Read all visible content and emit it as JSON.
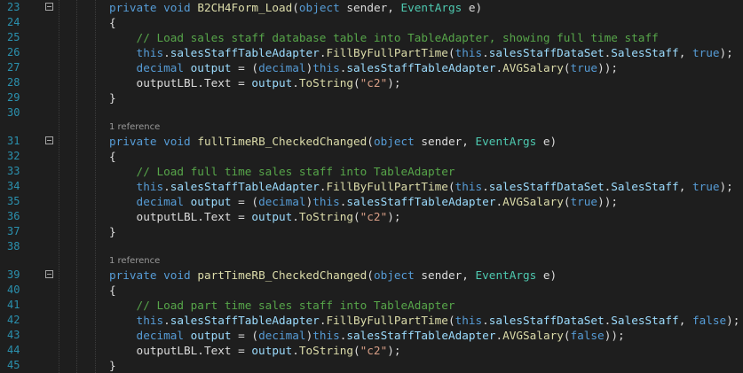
{
  "editor": {
    "lines": [
      {
        "num": "23",
        "tokens": [
          [
            "kw",
            "private"
          ],
          [
            "pl",
            " "
          ],
          [
            "kw",
            "void"
          ],
          [
            "pl",
            " "
          ],
          [
            "fx",
            "B2CH4Form_Load"
          ],
          [
            "pl",
            "("
          ],
          [
            "kw",
            "object"
          ],
          [
            "pl",
            " sender, "
          ],
          [
            "ty",
            "EventArgs"
          ],
          [
            "pl",
            " e)"
          ]
        ]
      },
      {
        "num": "24",
        "tokens": [
          [
            "pl",
            "{"
          ]
        ]
      },
      {
        "num": "25",
        "tokens": [
          [
            "cm",
            "    // Load sales staff database table into TableAdapter, showing full time staff"
          ]
        ]
      },
      {
        "num": "26",
        "tokens": [
          [
            "kw",
            "    this"
          ],
          [
            "pl",
            "."
          ],
          [
            "pr",
            "salesStaffTableAdapter"
          ],
          [
            "pl",
            "."
          ],
          [
            "mt",
            "FillByFullPartTime"
          ],
          [
            "pl",
            "("
          ],
          [
            "kw",
            "this"
          ],
          [
            "pl",
            "."
          ],
          [
            "pr",
            "salesStaffDataSet"
          ],
          [
            "pl",
            "."
          ],
          [
            "pr",
            "SalesStaff"
          ],
          [
            "pl",
            ", "
          ],
          [
            "kw",
            "true"
          ],
          [
            "pl",
            ");"
          ]
        ]
      },
      {
        "num": "27",
        "tokens": [
          [
            "kw",
            "    decimal"
          ],
          [
            "pl",
            " "
          ],
          [
            "pr",
            "output"
          ],
          [
            "pl",
            " = ("
          ],
          [
            "kw",
            "decimal"
          ],
          [
            "pl",
            ")"
          ],
          [
            "kw",
            "this"
          ],
          [
            "pl",
            "."
          ],
          [
            "pr",
            "salesStaffTableAdapter"
          ],
          [
            "pl",
            "."
          ],
          [
            "mt",
            "AVGSalary"
          ],
          [
            "pl",
            "("
          ],
          [
            "kw",
            "true"
          ],
          [
            "pl",
            "));"
          ]
        ]
      },
      {
        "num": "28",
        "tokens": [
          [
            "pl",
            "    outputLBL.Text = "
          ],
          [
            "pr",
            "output"
          ],
          [
            "pl",
            "."
          ],
          [
            "mt",
            "ToString"
          ],
          [
            "pl",
            "("
          ],
          [
            "st",
            "\"c2\""
          ],
          [
            "pl",
            ");"
          ]
        ]
      },
      {
        "num": "29",
        "tokens": [
          [
            "pl",
            "}"
          ]
        ]
      },
      {
        "num": "30",
        "tokens": []
      },
      {
        "num": "31",
        "tokens": [
          [
            "kw",
            "private"
          ],
          [
            "pl",
            " "
          ],
          [
            "kw",
            "void"
          ],
          [
            "pl",
            " "
          ],
          [
            "fx",
            "fullTimeRB_CheckedChanged"
          ],
          [
            "pl",
            "("
          ],
          [
            "kw",
            "object"
          ],
          [
            "pl",
            " sender, "
          ],
          [
            "ty",
            "EventArgs"
          ],
          [
            "pl",
            " e)"
          ]
        ]
      },
      {
        "num": "32",
        "tokens": [
          [
            "pl",
            "{"
          ]
        ]
      },
      {
        "num": "33",
        "tokens": [
          [
            "cm",
            "    // Load full time sales staff into TableAdapter"
          ]
        ]
      },
      {
        "num": "34",
        "tokens": [
          [
            "kw",
            "    this"
          ],
          [
            "pl",
            "."
          ],
          [
            "pr",
            "salesStaffTableAdapter"
          ],
          [
            "pl",
            "."
          ],
          [
            "mt",
            "FillByFullPartTime"
          ],
          [
            "pl",
            "("
          ],
          [
            "kw",
            "this"
          ],
          [
            "pl",
            "."
          ],
          [
            "pr",
            "salesStaffDataSet"
          ],
          [
            "pl",
            "."
          ],
          [
            "pr",
            "SalesStaff"
          ],
          [
            "pl",
            ", "
          ],
          [
            "kw",
            "true"
          ],
          [
            "pl",
            ");"
          ]
        ]
      },
      {
        "num": "35",
        "tokens": [
          [
            "kw",
            "    decimal"
          ],
          [
            "pl",
            " "
          ],
          [
            "pr",
            "output"
          ],
          [
            "pl",
            " = ("
          ],
          [
            "kw",
            "decimal"
          ],
          [
            "pl",
            ")"
          ],
          [
            "kw",
            "this"
          ],
          [
            "pl",
            "."
          ],
          [
            "pr",
            "salesStaffTableAdapter"
          ],
          [
            "pl",
            "."
          ],
          [
            "mt",
            "AVGSalary"
          ],
          [
            "pl",
            "("
          ],
          [
            "kw",
            "true"
          ],
          [
            "pl",
            "));"
          ]
        ]
      },
      {
        "num": "36",
        "tokens": [
          [
            "pl",
            "    outputLBL.Text = "
          ],
          [
            "pr",
            "output"
          ],
          [
            "pl",
            "."
          ],
          [
            "mt",
            "ToString"
          ],
          [
            "pl",
            "("
          ],
          [
            "st",
            "\"c2\""
          ],
          [
            "pl",
            ");"
          ]
        ]
      },
      {
        "num": "37",
        "tokens": [
          [
            "pl",
            "}"
          ]
        ]
      },
      {
        "num": "38",
        "tokens": []
      },
      {
        "num": "39",
        "tokens": [
          [
            "kw",
            "private"
          ],
          [
            "pl",
            " "
          ],
          [
            "kw",
            "void"
          ],
          [
            "pl",
            " "
          ],
          [
            "fx",
            "partTimeRB_CheckedChanged"
          ],
          [
            "pl",
            "("
          ],
          [
            "kw",
            "object"
          ],
          [
            "pl",
            " sender, "
          ],
          [
            "ty",
            "EventArgs"
          ],
          [
            "pl",
            " e)"
          ]
        ]
      },
      {
        "num": "40",
        "tokens": [
          [
            "pl",
            "{"
          ]
        ]
      },
      {
        "num": "41",
        "tokens": [
          [
            "cm",
            "    // Load part time sales staff into TableAdapter"
          ]
        ]
      },
      {
        "num": "42",
        "tokens": [
          [
            "kw",
            "    this"
          ],
          [
            "pl",
            "."
          ],
          [
            "pr",
            "salesStaffTableAdapter"
          ],
          [
            "pl",
            "."
          ],
          [
            "mt",
            "FillByFullPartTime"
          ],
          [
            "pl",
            "("
          ],
          [
            "kw",
            "this"
          ],
          [
            "pl",
            "."
          ],
          [
            "pr",
            "salesStaffDataSet"
          ],
          [
            "pl",
            "."
          ],
          [
            "pr",
            "SalesStaff"
          ],
          [
            "pl",
            ", "
          ],
          [
            "kw",
            "false"
          ],
          [
            "pl",
            ");"
          ]
        ]
      },
      {
        "num": "43",
        "tokens": [
          [
            "kw",
            "    decimal"
          ],
          [
            "pl",
            " "
          ],
          [
            "pr",
            "output"
          ],
          [
            "pl",
            " = ("
          ],
          [
            "kw",
            "decimal"
          ],
          [
            "pl",
            ")"
          ],
          [
            "kw",
            "this"
          ],
          [
            "pl",
            "."
          ],
          [
            "pr",
            "salesStaffTableAdapter"
          ],
          [
            "pl",
            "."
          ],
          [
            "mt",
            "AVGSalary"
          ],
          [
            "pl",
            "("
          ],
          [
            "kw",
            "false"
          ],
          [
            "pl",
            "));"
          ]
        ]
      },
      {
        "num": "44",
        "tokens": [
          [
            "pl",
            "    outputLBL.Text = "
          ],
          [
            "pr",
            "output"
          ],
          [
            "pl",
            "."
          ],
          [
            "mt",
            "ToString"
          ],
          [
            "pl",
            "("
          ],
          [
            "st",
            "\"c2\""
          ],
          [
            "pl",
            ");"
          ]
        ]
      },
      {
        "num": "45",
        "tokens": [
          [
            "pl",
            "}"
          ]
        ]
      }
    ],
    "reference_label": "1 reference"
  },
  "colors": {
    "background": "#1e1e1e",
    "line_number": "#2b91af",
    "keyword": "#569cd6",
    "type": "#4ec9b0",
    "method": "#dcdcaa",
    "property": "#9cdcfe",
    "comment": "#57a64a",
    "string": "#d69d85",
    "plain": "#dcdcdc"
  }
}
